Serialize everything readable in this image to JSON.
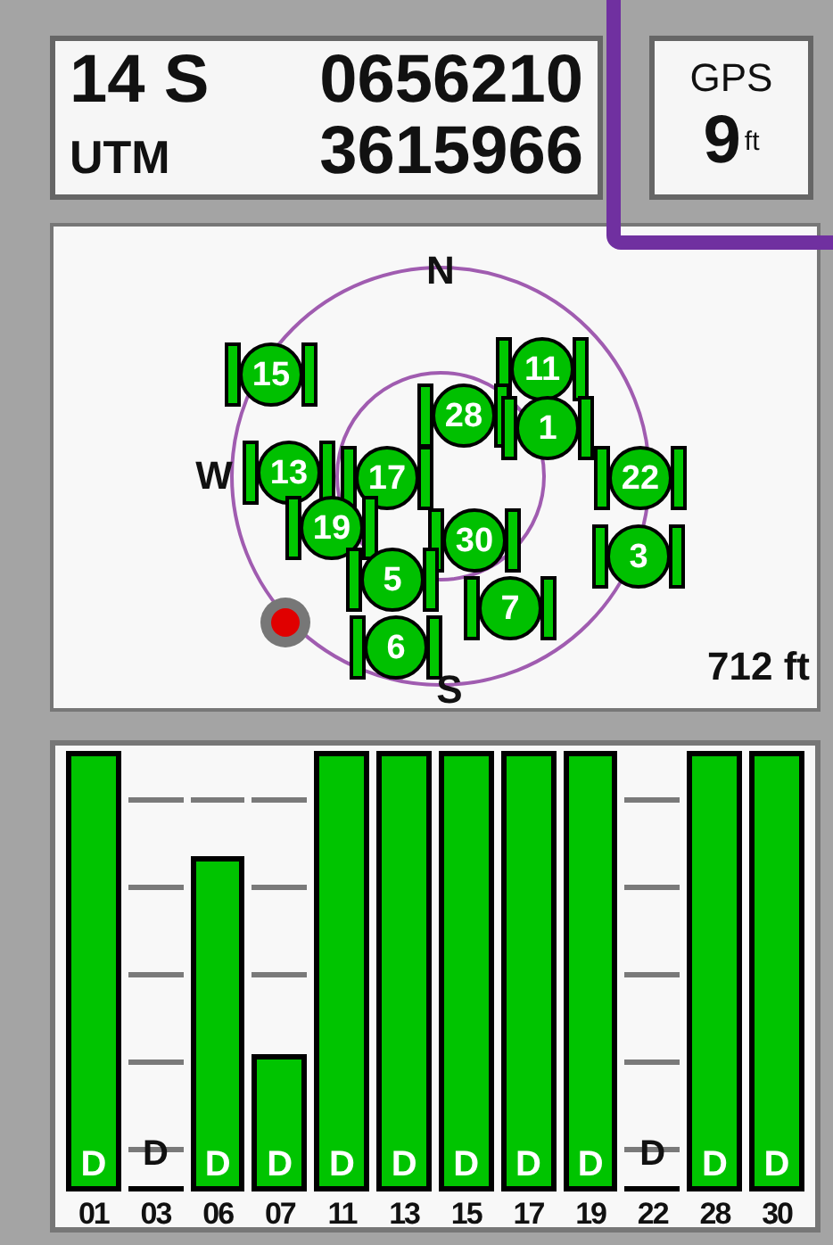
{
  "position": {
    "zone": "14 S",
    "easting": "0656210",
    "format": "UTM",
    "northing": "3615966"
  },
  "accuracy": {
    "label": "GPS",
    "value": "9",
    "unit": "ft"
  },
  "sky_view": {
    "compass": [
      {
        "label": "N"
      },
      {
        "label": "W"
      },
      {
        "label": "S"
      }
    ],
    "satellites": [
      {
        "number": "15"
      },
      {
        "number": "11"
      },
      {
        "number": "28"
      },
      {
        "number": "1"
      },
      {
        "number": "13"
      },
      {
        "number": "17"
      },
      {
        "number": "22"
      },
      {
        "number": "19"
      },
      {
        "number": "30"
      },
      {
        "number": "3"
      },
      {
        "number": "5"
      },
      {
        "number": "7"
      },
      {
        "number": "6"
      }
    ],
    "scale": "712 ft"
  },
  "signal_bars": [
    {
      "number": "01",
      "level": 1,
      "flag": "D"
    },
    {
      "number": "03",
      "level": 0,
      "flag": "D"
    },
    {
      "number": "06",
      "level": 0.76,
      "flag": "D"
    },
    {
      "number": "07",
      "level": 0.31,
      "flag": "D"
    },
    {
      "number": "11",
      "level": 1,
      "flag": "D"
    },
    {
      "number": "13",
      "level": 1,
      "flag": "D"
    },
    {
      "number": "15",
      "level": 1,
      "flag": "D"
    },
    {
      "number": "17",
      "level": 1,
      "flag": "D"
    },
    {
      "number": "19",
      "level": 1,
      "flag": "D"
    },
    {
      "number": "22",
      "level": 0,
      "flag": "D"
    },
    {
      "number": "28",
      "level": 1,
      "flag": "D"
    },
    {
      "number": "30",
      "level": 1,
      "flag": "D"
    }
  ]
}
